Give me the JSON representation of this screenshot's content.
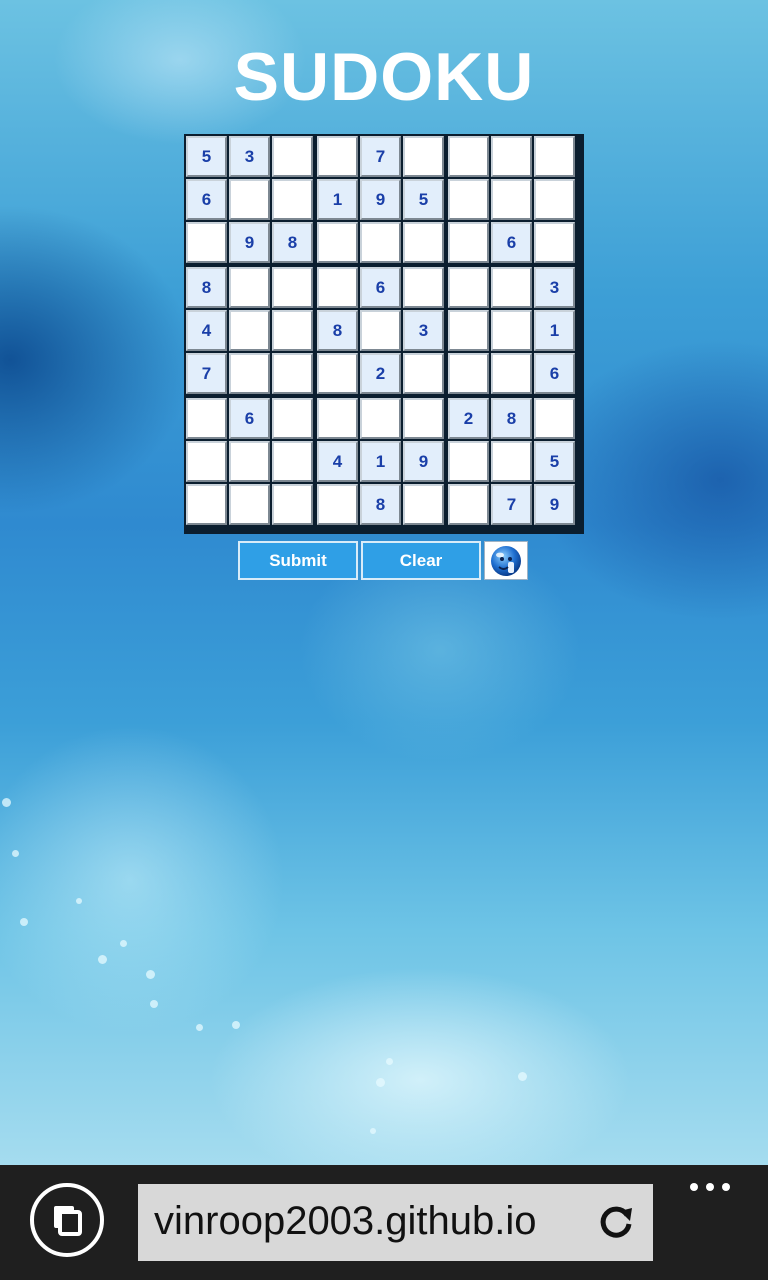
{
  "page": {
    "title": "SUDOKU"
  },
  "grid": [
    [
      "5",
      "3",
      "",
      "",
      "7",
      "",
      "",
      "",
      ""
    ],
    [
      "6",
      "",
      "",
      "1",
      "9",
      "5",
      "",
      "",
      ""
    ],
    [
      "",
      "9",
      "8",
      "",
      "",
      "",
      "",
      "6",
      ""
    ],
    [
      "8",
      "",
      "",
      "",
      "6",
      "",
      "",
      "",
      "3"
    ],
    [
      "4",
      "",
      "",
      "8",
      "",
      "3",
      "",
      "",
      "1"
    ],
    [
      "7",
      "",
      "",
      "",
      "2",
      "",
      "",
      "",
      "6"
    ],
    [
      "",
      "6",
      "",
      "",
      "",
      "",
      "2",
      "8",
      ""
    ],
    [
      "",
      "",
      "",
      "4",
      "1",
      "9",
      "",
      "",
      "5"
    ],
    [
      "",
      "",
      "",
      "",
      "8",
      "",
      "",
      "7",
      "9"
    ]
  ],
  "buttons": {
    "submit": "Submit",
    "clear": "Clear",
    "hint_icon": "help-smiley-icon"
  },
  "browser": {
    "url": "vinroop2003.github.io",
    "tabs_icon": "tabs-icon",
    "refresh_icon": "refresh-icon",
    "more_icon": "more-icon"
  },
  "colors": {
    "title": "#ffffff",
    "digit": "#1a3fa8",
    "given_cell": "#e2eefb",
    "empty_cell": "#ffffff",
    "button": "#2f9fe6",
    "app_bar": "#1f1f1f",
    "address_bar": "#d8d8d8"
  }
}
